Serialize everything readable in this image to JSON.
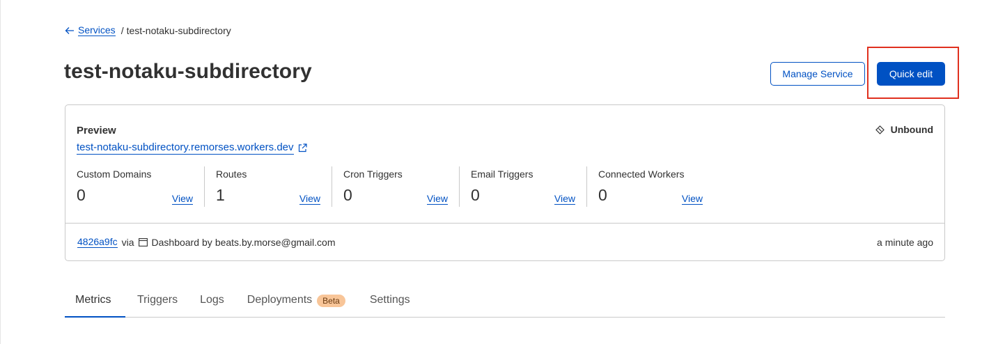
{
  "breadcrumb": {
    "back_label": "Services",
    "separator": "/",
    "current": "test-notaku-subdirectory"
  },
  "page": {
    "title": "test-notaku-subdirectory"
  },
  "actions": {
    "manage_label": "Manage Service",
    "quick_edit_label": "Quick edit"
  },
  "preview": {
    "label": "Preview",
    "url": "test-notaku-subdirectory.remorses.workers.dev",
    "status": "Unbound"
  },
  "stats": [
    {
      "label": "Custom Domains",
      "value": "0",
      "view": "View"
    },
    {
      "label": "Routes",
      "value": "1",
      "view": "View"
    },
    {
      "label": "Cron Triggers",
      "value": "0",
      "view": "View"
    },
    {
      "label": "Email Triggers",
      "value": "0",
      "view": "View"
    },
    {
      "label": "Connected Workers",
      "value": "0",
      "view": "View"
    }
  ],
  "deployment": {
    "commit": "4826a9fc",
    "via": "via",
    "source": "Dashboard",
    "by": "by",
    "user": "beats.by.morse@gmail.com",
    "time": "a minute ago"
  },
  "tabs": [
    {
      "label": "Metrics",
      "active": true
    },
    {
      "label": "Triggers",
      "active": false
    },
    {
      "label": "Logs",
      "active": false
    },
    {
      "label": "Deployments",
      "active": false,
      "badge": "Beta"
    },
    {
      "label": "Settings",
      "active": false
    }
  ],
  "colors": {
    "accent": "#0051c3",
    "highlight": "#e0301e",
    "badge_bg": "#f8c598"
  },
  "icons": {
    "back": "arrow-left-icon",
    "external": "external-link-icon",
    "unbound": "unbound-diamond-icon",
    "dashboard": "dashboard-window-icon"
  }
}
